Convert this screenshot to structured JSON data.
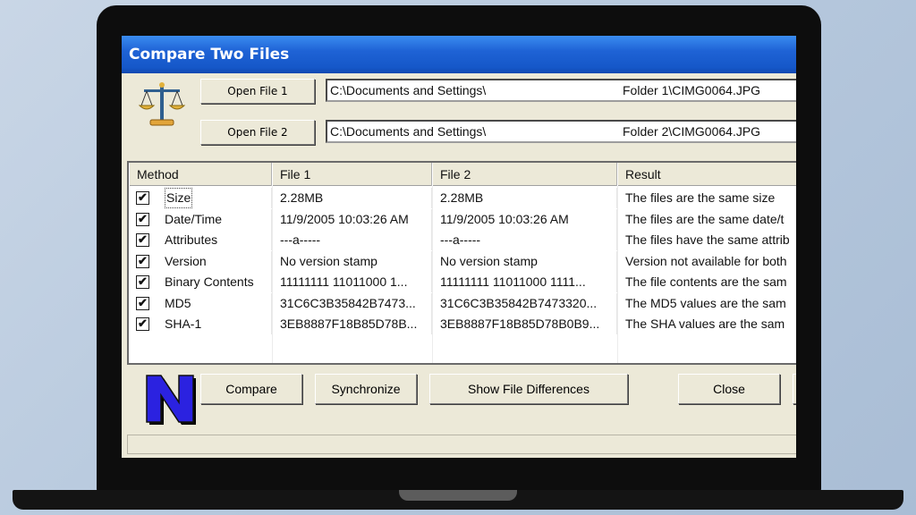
{
  "window": {
    "title": "Compare Two Files"
  },
  "files": [
    {
      "button_label": "Open File 1",
      "path_left": "C:\\Documents and Settings\\",
      "path_right": "Folder 1\\CIMG0064.JPG"
    },
    {
      "button_label": "Open File 2",
      "path_left": "C:\\Documents and Settings\\",
      "path_right": "Folder 2\\CIMG0064.JPG"
    }
  ],
  "table": {
    "columns": [
      "Method",
      "File 1",
      "File 2",
      "Result"
    ],
    "rows": [
      {
        "checked": true,
        "method": "Size",
        "file1": "2.28MB",
        "file2": "2.28MB",
        "result": "The files are the same size"
      },
      {
        "checked": true,
        "method": "Date/Time",
        "file1": "11/9/2005 10:03:26 AM",
        "file2": "11/9/2005 10:03:26 AM",
        "result": "The files are the same date/t"
      },
      {
        "checked": true,
        "method": "Attributes",
        "file1": "---a-----",
        "file2": "---a-----",
        "result": "The files have the same attrib"
      },
      {
        "checked": true,
        "method": "Version",
        "file1": "No version stamp",
        "file2": "No version stamp",
        "result": "Version not available for both"
      },
      {
        "checked": true,
        "method": "Binary Contents",
        "file1": "11111111 11011000 1...",
        "file2": "11111111 11011000 1111...",
        "result": "The file contents are the sam"
      },
      {
        "checked": true,
        "method": "MD5",
        "file1": "31C6C3B35842B7473...",
        "file2": "31C6C3B35842B7473320...",
        "result": "The MD5 values are the sam"
      },
      {
        "checked": true,
        "method": "SHA-1",
        "file1": "3EB8887F18B85D78B...",
        "file2": "3EB8887F18B85D78B0B9...",
        "result": "The SHA values are the sam"
      }
    ]
  },
  "actions": {
    "compare": "Compare",
    "synchronize": "Synchronize",
    "show_diff": "Show File Differences",
    "close": "Close"
  },
  "logo": {
    "letter": "N",
    "color": "#2b22e0"
  }
}
